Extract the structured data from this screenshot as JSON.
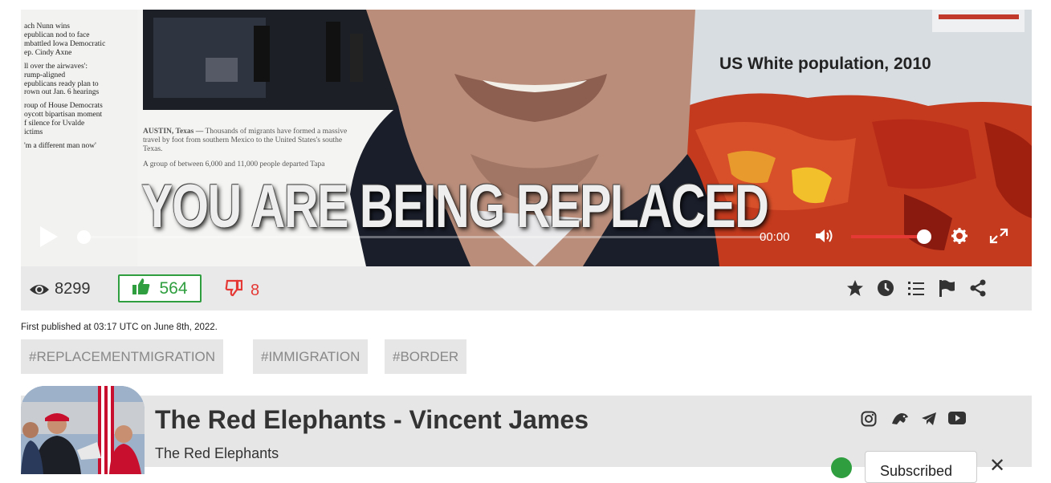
{
  "player": {
    "overlay_title": "YOU ARE BEING REPLACED",
    "map_title": "US White population, 2010",
    "article": {
      "sidebar": [
        "ach Nunn wins",
        "epublican nod to face",
        "mbattled Iowa Democratic",
        "ep. Cindy Axne",
        "",
        "ll over the airwaves':",
        "rump-aligned",
        "epublicans ready plan to",
        "rown out Jan. 6 hearings",
        "",
        "roup of House Democrats",
        "oycott bipartisan moment",
        "f silence for Uvalde",
        "ictims",
        "",
        "'m a different man now'"
      ],
      "dateline": "AUSTIN, Texas —",
      "body1": "Thousands of migrants have formed a massive",
      "body2": "travel by foot from southern Mexico to the United States's southe",
      "body3": "Texas.",
      "body4": "A group of between 6,000 and 11,000 people departed Tapa"
    },
    "time": "00:00",
    "play_icon": "play-icon",
    "volume_icon": "volume-icon",
    "settings_icon": "gear-icon",
    "fullscreen_icon": "fullscreen-icon",
    "progress": 0,
    "volume": 1.0
  },
  "stats": {
    "views": "8299",
    "likes": "564",
    "dislikes": "8",
    "actions": [
      "star-icon",
      "clock-icon",
      "list-icon",
      "flag-icon",
      "share-icon"
    ]
  },
  "published": "First published at 03:17 UTC on June 8th, 2022.",
  "tags": [
    "#REPLACEMENTMIGRATION",
    "#IMMIGRATION",
    "#BORDER"
  ],
  "channel": {
    "name": "The Red Elephants - Vincent James",
    "subtitle": "The Red Elephants",
    "social": [
      "instagram-icon",
      "gab-icon",
      "telegram-icon",
      "youtube-icon"
    ],
    "subscribe_label": "Subscribed"
  },
  "colors": {
    "like_green": "#2e9e3e",
    "dislike_red": "#e53935",
    "volume_red": "#e53935",
    "bar_gray": "#e9e9e9"
  }
}
